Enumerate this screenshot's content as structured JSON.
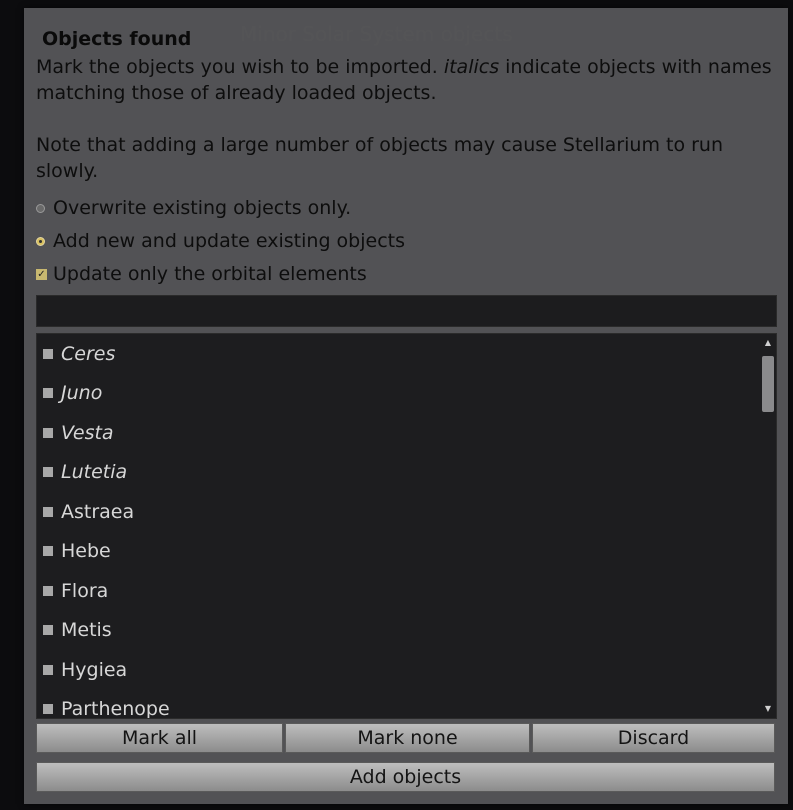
{
  "dialog": {
    "title": "Objects found",
    "description_line1_pre": "Mark the objects you wish to be imported. ",
    "description_italic_word": "italics",
    "description_line1_post": " indicate objects with names matching those of already loaded objects.",
    "description_line2": "Note that adding a large number of objects may cause Stellarium to run slowly."
  },
  "options": {
    "overwrite_label": "Overwrite existing objects only.",
    "add_update_label": "Add new and update existing objects",
    "add_update_selected": true,
    "orbital_only_label": "Update only the orbital elements",
    "orbital_only_checked": true
  },
  "search": {
    "value": ""
  },
  "objects": [
    {
      "name": "Ceres",
      "italic": true
    },
    {
      "name": "Juno",
      "italic": true
    },
    {
      "name": "Vesta",
      "italic": true
    },
    {
      "name": "Lutetia",
      "italic": true
    },
    {
      "name": "Astraea",
      "italic": false
    },
    {
      "name": "Hebe",
      "italic": false
    },
    {
      "name": "Flora",
      "italic": false
    },
    {
      "name": "Metis",
      "italic": false
    },
    {
      "name": "Hygiea",
      "italic": false
    },
    {
      "name": "Parthenope",
      "italic": false
    }
  ],
  "buttons": {
    "mark_all": "Mark all",
    "mark_none": "Mark none",
    "discard": "Discard",
    "add_objects": "Add objects"
  }
}
